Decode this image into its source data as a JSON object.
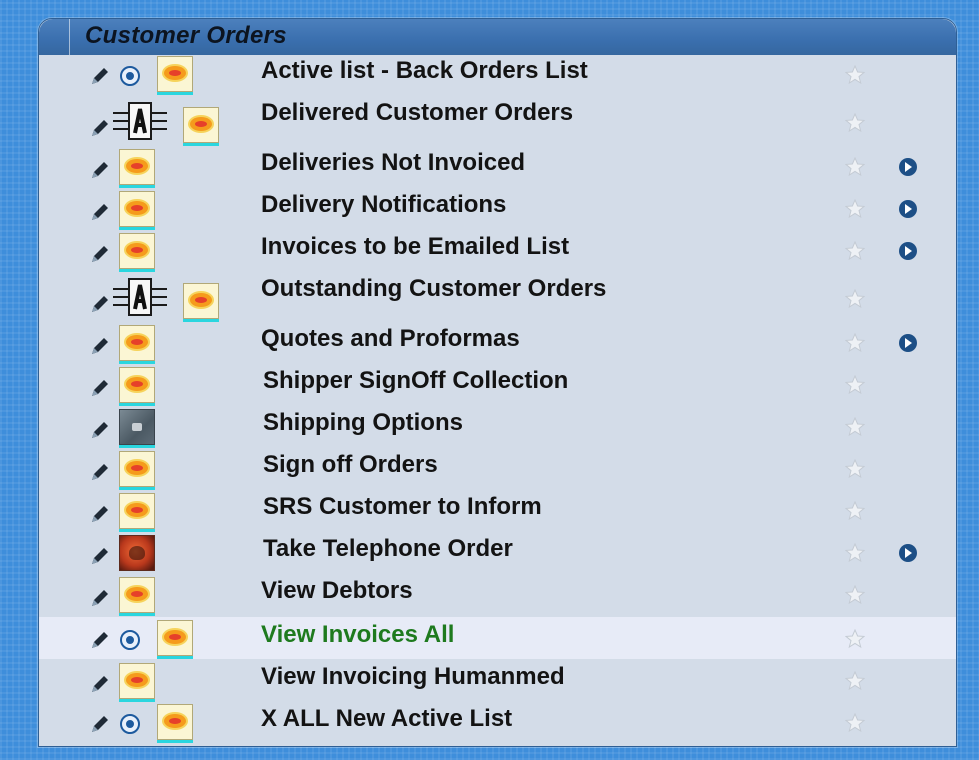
{
  "panel": {
    "title": "Customer Orders"
  },
  "icons": {
    "edit": "pencil-icon",
    "view": "eye-circle-icon",
    "report": "report-icon",
    "automation": "automation-chip-icon",
    "shipping": "shipping-icon",
    "telephone": "telephone-icon",
    "favorite": "star-icon",
    "run": "go-arrow-icon"
  },
  "colors": {
    "background": "#3e8edb",
    "panel": "#d3dce8",
    "header": "#3a6fae",
    "hover_row": "#e7ebf7",
    "hover_text": "#1e7a1e",
    "text": "#131313",
    "accent_underline": "#2ad6df"
  },
  "items": [
    {
      "label": "Active list - Back Orders List"
    },
    {
      "label": "Delivered Customer Orders"
    },
    {
      "label": "Deliveries Not Invoiced"
    },
    {
      "label": "Delivery Notifications"
    },
    {
      "label": "Invoices to be Emailed List"
    },
    {
      "label": "Outstanding Customer Orders"
    },
    {
      "label": "Quotes and Proformas"
    },
    {
      "label": "Shipper SignOff Collection"
    },
    {
      "label": "Shipping Options"
    },
    {
      "label": "Sign off Orders"
    },
    {
      "label": "SRS Customer to Inform"
    },
    {
      "label": "Take Telephone Order"
    },
    {
      "label": "View Debtors"
    },
    {
      "label": "View Invoices All"
    },
    {
      "label": "View Invoicing Humanmed"
    },
    {
      "label": "X ALL New Active List"
    }
  ]
}
